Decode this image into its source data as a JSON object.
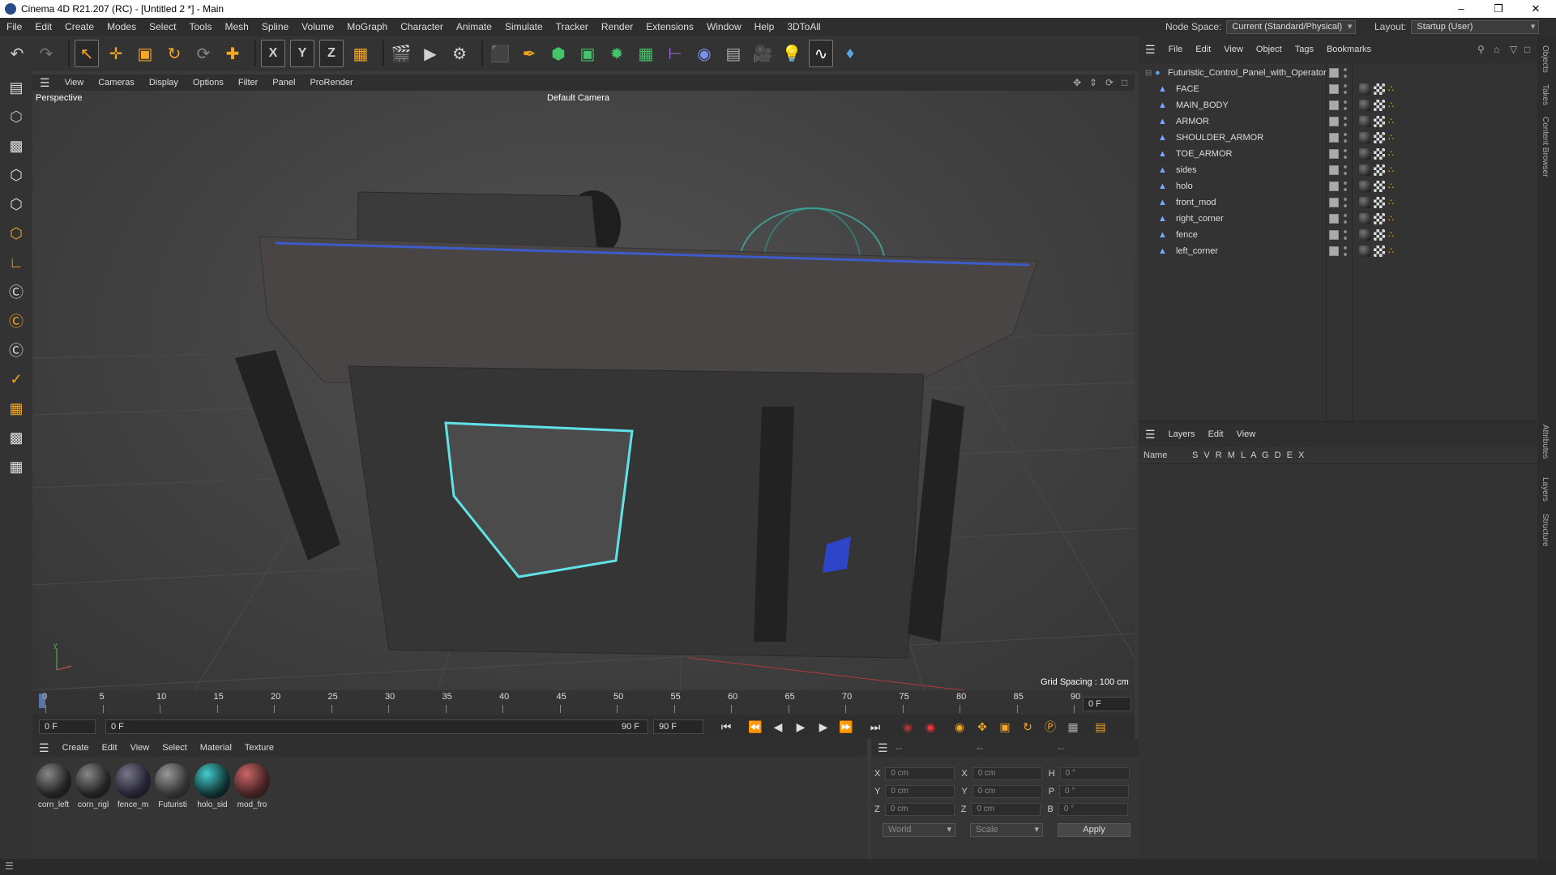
{
  "titlebar": {
    "title": "Cinema 4D R21.207 (RC) - [Untitled 2 *] - Main",
    "minimize": "–",
    "maximize": "❐",
    "close": "✕"
  },
  "menu": [
    "File",
    "Edit",
    "Create",
    "Modes",
    "Select",
    "Tools",
    "Mesh",
    "Spline",
    "Volume",
    "MoGraph",
    "Character",
    "Animate",
    "Simulate",
    "Tracker",
    "Render",
    "Extensions",
    "Window",
    "Help",
    "3DToAll"
  ],
  "nodespace": {
    "label": "Node Space:",
    "value": "Current (Standard/Physical)"
  },
  "layout": {
    "label": "Layout:",
    "value": "Startup (User)"
  },
  "toolbar": {
    "undo": "↶",
    "redo": "↷",
    "select": "↖",
    "move": "✛",
    "scale": "▣",
    "rotate": "↻",
    "axis_x": "X",
    "axis_y": "Y",
    "axis_z": "Z"
  },
  "viewport": {
    "menu": [
      "View",
      "Cameras",
      "Display",
      "Options",
      "Filter",
      "Panel",
      "ProRender"
    ],
    "label": "Perspective",
    "camera": "Default Camera",
    "grid": "Grid Spacing : 100 cm"
  },
  "timeline": {
    "ticks": [
      "0",
      "5",
      "10",
      "15",
      "20",
      "25",
      "30",
      "35",
      "40",
      "45",
      "50",
      "55",
      "60",
      "65",
      "70",
      "75",
      "80",
      "85",
      "90"
    ],
    "current": "0 F"
  },
  "playbar": {
    "start": "0 F",
    "pos": "0 F",
    "end": "90 F",
    "max": "90 F"
  },
  "materials": {
    "menu": [
      "Create",
      "Edit",
      "View",
      "Select",
      "Material",
      "Texture"
    ],
    "items": [
      "corn_left",
      "corn_rigl",
      "fence_m",
      "Futuristi",
      "holo_sid",
      "mod_fro"
    ]
  },
  "coords": {
    "header": [
      "--",
      "--",
      "--"
    ],
    "rows": [
      {
        "a": "X",
        "av": "0 cm",
        "b": "X",
        "bv": "0 cm",
        "c": "H",
        "cv": "0 °"
      },
      {
        "a": "Y",
        "av": "0 cm",
        "b": "Y",
        "bv": "0 cm",
        "c": "P",
        "cv": "0 °"
      },
      {
        "a": "Z",
        "av": "0 cm",
        "b": "Z",
        "bv": "0 cm",
        "c": "B",
        "cv": "0 °"
      }
    ],
    "world": "World",
    "scale": "Scale",
    "apply": "Apply"
  },
  "objects": {
    "menu": [
      "File",
      "Edit",
      "View",
      "Object",
      "Tags",
      "Bookmarks"
    ],
    "root": "Futuristic_Control_Panel_with_Operator",
    "items": [
      "FACE",
      "MAIN_BODY",
      "ARMOR",
      "SHOULDER_ARMOR",
      "TOE_ARMOR",
      "sides",
      "holo",
      "front_mod",
      "right_corner",
      "fence",
      "left_corner"
    ]
  },
  "layers": {
    "menu": [
      "Layers",
      "Edit",
      "View"
    ],
    "name": "Name",
    "cols": "S V R M L A G D E X"
  },
  "sidetabs": [
    "Objects",
    "Takes",
    "Content Browser",
    "Attributes",
    "Layers",
    "Structure"
  ]
}
